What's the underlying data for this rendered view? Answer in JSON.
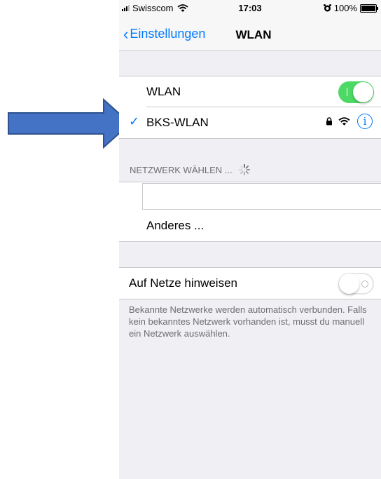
{
  "status_bar": {
    "carrier": "Swisscom",
    "time": "17:03",
    "battery": "100%"
  },
  "nav": {
    "back_label": "Einstellungen",
    "title": "WLAN"
  },
  "wlan_row": {
    "label": "WLAN",
    "enabled": true
  },
  "current_network": {
    "name": "BKS-WLAN"
  },
  "section": {
    "header": "NETZWERK WÄHLEN ...",
    "other_label": "Anderes ..."
  },
  "ask_to_join": {
    "label": "Auf Netze hinweisen",
    "enabled": false
  },
  "footer": {
    "text": "Bekannte Netzwerke werden automatisch verbunden. Falls kein bekanntes Netzwerk vorhanden ist, musst du manuell ein Netzwerk auswählen."
  },
  "colors": {
    "accent": "#007aff",
    "toggle_on": "#4cd964",
    "arrow_fill": "#4472c4",
    "arrow_stroke": "#2f528f"
  }
}
